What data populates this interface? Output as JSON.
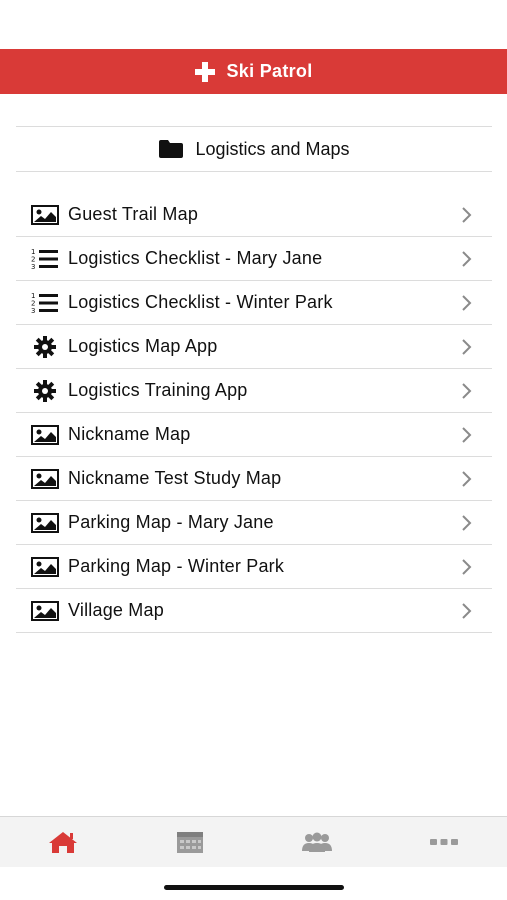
{
  "header": {
    "title": "Ski Patrol",
    "icon": "plus-icon"
  },
  "section": {
    "title": "Logistics and Maps",
    "icon": "folder-icon"
  },
  "items": [
    {
      "label": "Guest Trail Map",
      "icon": "image-icon"
    },
    {
      "label": "Logistics Checklist - Mary Jane",
      "icon": "numbered-list-icon"
    },
    {
      "label": "Logistics Checklist - Winter Park",
      "icon": "numbered-list-icon"
    },
    {
      "label": "Logistics Map App",
      "icon": "gear-icon"
    },
    {
      "label": "Logistics Training App",
      "icon": "gear-icon"
    },
    {
      "label": "Nickname Map",
      "icon": "image-icon"
    },
    {
      "label": "Nickname Test Study Map",
      "icon": "image-icon"
    },
    {
      "label": "Parking Map - Mary Jane",
      "icon": "image-icon"
    },
    {
      "label": "Parking Map - Winter Park",
      "icon": "image-icon"
    },
    {
      "label": "Village Map",
      "icon": "image-icon"
    }
  ],
  "tabs": [
    {
      "name": "home",
      "icon": "home-icon",
      "active": true
    },
    {
      "name": "calendar",
      "icon": "calendar-icon",
      "active": false
    },
    {
      "name": "people",
      "icon": "people-icon",
      "active": false
    },
    {
      "name": "more",
      "icon": "more-icon",
      "active": false
    }
  ],
  "colors": {
    "brand": "#d93a37",
    "tab_active": "#d93a37",
    "tab_inactive": "#9a9a9a"
  }
}
